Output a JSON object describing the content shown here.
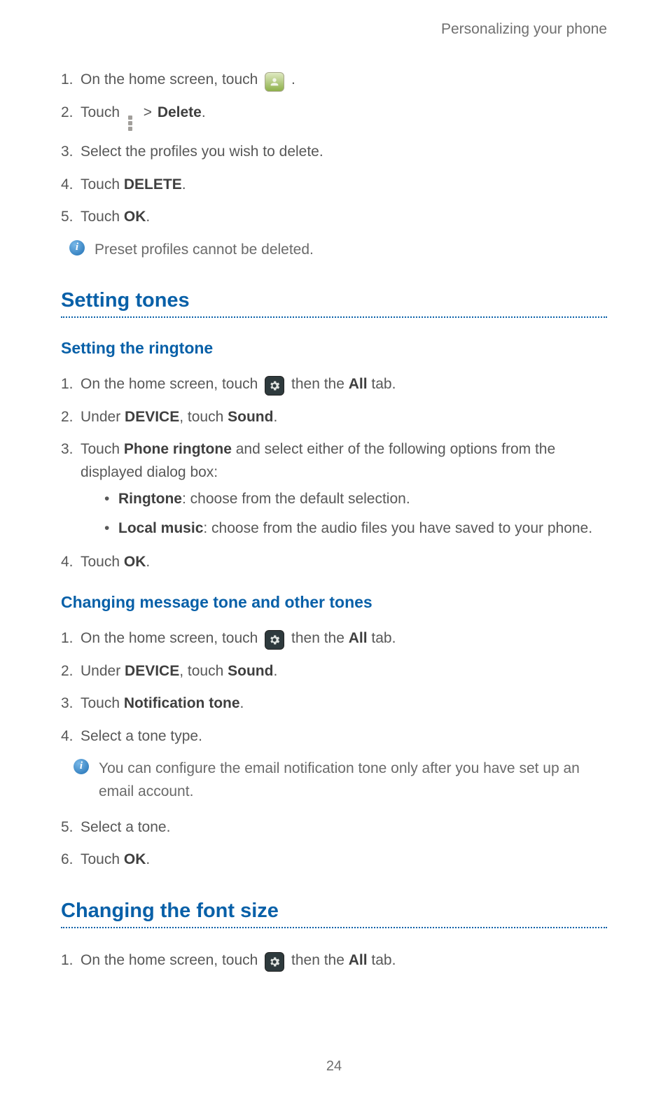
{
  "runningHead": "Personalizing your phone",
  "pageNumber": "24",
  "deleteProfiles": {
    "step1_pre": "On the home screen, touch ",
    "step1_post": ".",
    "step2_pre": "Touch ",
    "step2_delete": "Delete",
    "step2_post": ".",
    "step3": "Select the profiles you wish to delete.",
    "step4_pre": "Touch ",
    "step4_strong": "DELETE",
    "step4_post": ".",
    "step5_pre": "Touch ",
    "step5_strong": "OK",
    "step5_post": ".",
    "note": "Preset profiles cannot be deleted."
  },
  "section1Title": "Setting tones",
  "ringtone": {
    "title": "Setting the ringtone",
    "s1_pre": "On the home screen, touch ",
    "s1_mid": " then the ",
    "s1_all": "All",
    "s1_post": " tab.",
    "s2_pre": "Under ",
    "s2_device": "DEVICE",
    "s2_mid": ", touch ",
    "s2_sound": "Sound",
    "s2_post": ".",
    "s3_pre": "Touch ",
    "s3_pr": "Phone ringtone",
    "s3_post": " and select either of the following options from the displayed dialog box:",
    "b1_strong": "Ringtone",
    "b1_rest": ": choose from the default selection.",
    "b2_strong": "Local music",
    "b2_rest": ": choose from the audio files you have saved to your phone.",
    "s4_pre": "Touch ",
    "s4_ok": "OK",
    "s4_post": "."
  },
  "otherTones": {
    "title": "Changing message tone and other tones",
    "s1_pre": "On the home screen, touch ",
    "s1_mid": " then the ",
    "s1_all": "All",
    "s1_post": " tab.",
    "s2_pre": "Under ",
    "s2_device": "DEVICE",
    "s2_mid": ", touch ",
    "s2_sound": "Sound",
    "s2_post": ".",
    "s3_pre": "Touch ",
    "s3_nt": "Notification tone",
    "s3_post": ".",
    "s4": "Select a tone type.",
    "note": "You can configure the email notification tone only after you have set up an email account.",
    "s5": "Select a tone.",
    "s6_pre": "Touch ",
    "s6_ok": "OK",
    "s6_post": "."
  },
  "section2Title": "Changing the font size",
  "fontSize": {
    "s1_pre": "On the home screen, touch ",
    "s1_mid": " then the ",
    "s1_all": "All",
    "s1_post": " tab."
  },
  "stepNums": {
    "n1": "1.",
    "n2": "2.",
    "n3": "3.",
    "n4": "4.",
    "n5": "5.",
    "n6": "6."
  },
  "gt": ">"
}
